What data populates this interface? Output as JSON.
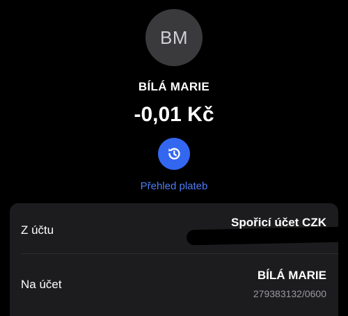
{
  "contact": {
    "initials": "BM",
    "name": "BÍLÁ MARIE"
  },
  "transaction": {
    "amount": "-0,01 Kč"
  },
  "actions": {
    "history_label": "Přehled plateb",
    "history_icon": "history-icon"
  },
  "colors": {
    "accent": "#3467f0",
    "accent_text": "#4f7cf5",
    "card_bg": "#1c1c1e",
    "avatar_bg": "#3a3a3d"
  },
  "details": {
    "from": {
      "label": "Z účtu",
      "value": "Spořicí účet CZK"
    },
    "to": {
      "label": "Na účet",
      "value": "BÍLÁ MARIE",
      "account": "279383132/0600"
    }
  }
}
